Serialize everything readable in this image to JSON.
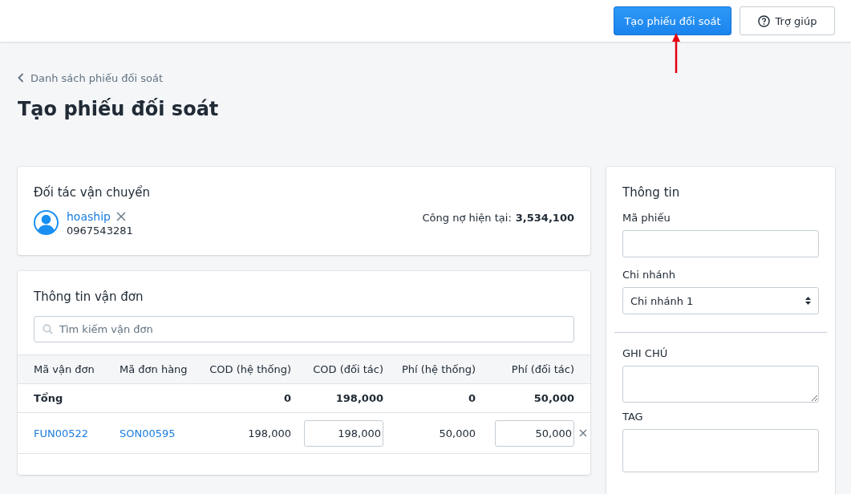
{
  "header": {
    "primary_button": "Tạo phiếu đối soát",
    "help_button": "Trợ giúp"
  },
  "breadcrumb": "Danh sách phiếu đối soát",
  "page_title": "Tạo phiếu đối soát",
  "carrier_card": {
    "title": "Đối tác vận chuyển",
    "carrier_name": "hoaship",
    "phone": "0967543281",
    "debt_label": "Công nợ hiện tại:",
    "debt_value": "3,534,100"
  },
  "waybill_card": {
    "title": "Thông tin vận đơn",
    "search": {
      "placeholder": "Tìm kiếm vận đơn"
    },
    "table": {
      "columns": [
        "Mã vận đơn",
        "Mã đơn hàng",
        "COD (hệ thống)",
        "COD (đối tác)",
        "Phí (hệ thống)",
        "Phí (đối tác)"
      ],
      "total_row": {
        "label": "Tổng",
        "cod_system": "0",
        "cod_partner": "198,000",
        "fee_system": "0",
        "fee_partner": "50,000"
      },
      "rows": [
        {
          "waybill": "FUN00522",
          "order": "SON00595",
          "cod_system": "198,000",
          "cod_partner": "198,000",
          "fee_system": "50,000",
          "fee_partner": "50,000"
        }
      ]
    }
  },
  "info_card": {
    "title": "Thông tin",
    "code_label": "Mã phiếu",
    "branch_label": "Chi nhánh",
    "branch_value": "Chi nhánh 1",
    "note_label": "GHI CHÚ",
    "tag_label": "TAG"
  }
}
